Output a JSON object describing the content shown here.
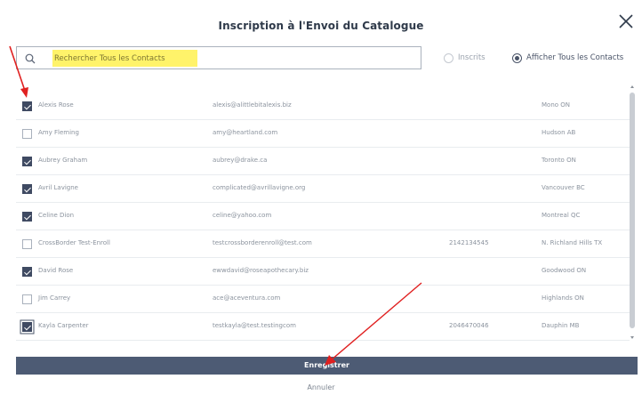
{
  "dialog": {
    "title": "Inscription à l'Envoi du Catalogue"
  },
  "search": {
    "placeholder": "Rechercher Tous les Contacts",
    "icon": "search-icon"
  },
  "filters": {
    "options": [
      {
        "label": "Inscrits",
        "selected": false
      },
      {
        "label": "Afficher Tous les Contacts",
        "selected": true
      }
    ]
  },
  "contacts": [
    {
      "name": "Alexis Rose",
      "email": "alexis@alittlebitalexis.biz",
      "phone": "",
      "location": "Mono ON",
      "checked": true
    },
    {
      "name": "Amy Fleming",
      "email": "amy@heartland.com",
      "phone": "",
      "location": "Hudson AB",
      "checked": false
    },
    {
      "name": "Aubrey Graham",
      "email": "aubrey@drake.ca",
      "phone": "",
      "location": "Toronto ON",
      "checked": true
    },
    {
      "name": "Avril Lavigne",
      "email": "complicated@avrillavigne.org",
      "phone": "",
      "location": "Vancouver BC",
      "checked": true
    },
    {
      "name": "Celine Dion",
      "email": "celine@yahoo.com",
      "phone": "",
      "location": "Montreal QC",
      "checked": true
    },
    {
      "name": "CrossBorder Test-Enroll",
      "email": "testcrossborderenroll@test.com",
      "phone": "2142134545",
      "location": "N. Richland Hills TX",
      "checked": false
    },
    {
      "name": "David Rose",
      "email": "ewwdavid@roseapothecary.biz",
      "phone": "",
      "location": "Goodwood ON",
      "checked": true
    },
    {
      "name": "Jim Carrey",
      "email": "ace@aceventura.com",
      "phone": "",
      "location": "Highlands ON",
      "checked": false
    },
    {
      "name": "Kayla Carpenter",
      "email": "testkayla@test.testingcom",
      "phone": "2046470046",
      "location": "Dauphin MB",
      "checked": true
    }
  ],
  "actions": {
    "save_label": "Enregistrer",
    "cancel_label": "Annuler"
  },
  "colors": {
    "primary": "#4d5b74",
    "checkbox": "#3f4a62",
    "highlight": "#fff36a",
    "annotation_arrow": "#e02020"
  }
}
